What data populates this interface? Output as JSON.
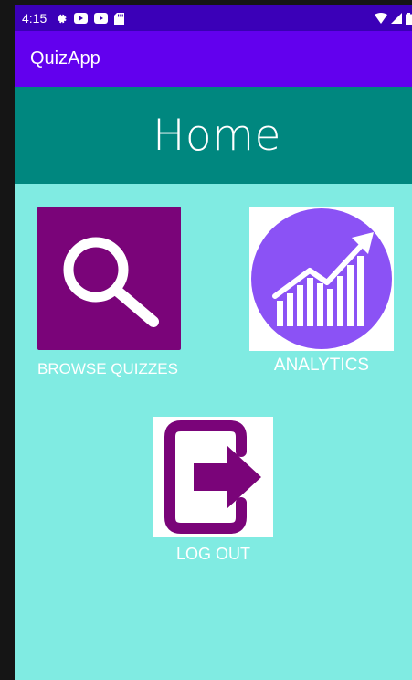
{
  "status_bar": {
    "time": "4:15",
    "left_icons": [
      "settings-icon",
      "youtube-icon",
      "youtube-icon",
      "sd-card-icon"
    ],
    "right_icons": [
      "wifi-icon",
      "signal-icon",
      "battery-icon"
    ]
  },
  "app_bar": {
    "title": "QuizApp"
  },
  "header": {
    "title": "Home"
  },
  "tiles": {
    "browse": {
      "label": "BROWSE QUIZZES",
      "icon": "search-icon"
    },
    "analytics": {
      "label": "ANALYTICS",
      "icon": "analytics-chart-icon"
    },
    "logout": {
      "label": "LOG OUT",
      "icon": "logout-icon"
    }
  },
  "colors": {
    "status_bar": "#3b00b8",
    "app_bar": "#6200ee",
    "header_band": "#00877f",
    "background": "#80ebe2",
    "purple_accent": "#7a0479",
    "analytics_circle": "#8b52f5"
  }
}
